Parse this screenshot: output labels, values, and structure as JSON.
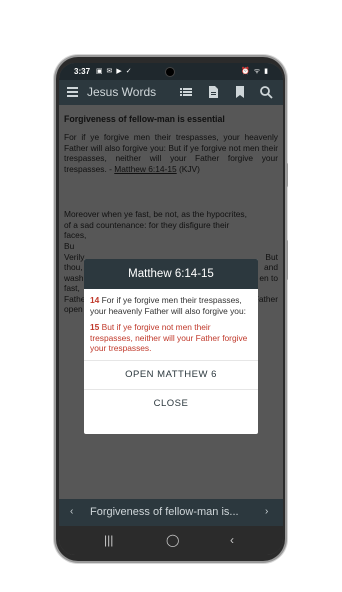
{
  "status_bar": {
    "time": "3:37",
    "left_icons": "▣ ✉ ▶ ✓",
    "right_icons": "⏰ ᯤ ▮"
  },
  "app_bar": {
    "title": "Jesus Words",
    "icons": [
      "menu-icon",
      "list-icon",
      "document-icon",
      "bookmark-icon",
      "search-icon"
    ]
  },
  "content": {
    "heading": "Forgiveness of fellow-man is essential",
    "paragraph1_pre": "For if ye forgive men their trespasses, your heavenly Father will also forgive you: But if ye forgive not men their trespasses, neither will your Father forgive your trespasses. - ",
    "paragraph1_link": "Matthew 6:14-15",
    "paragraph1_post": " (KJV)",
    "paragraph2_lines": [
      "Moreover when ye fast, be not, as the hypocrites,",
      "of a sad countenance: for they disfigure their",
      "faces,",
      "Bu",
      "Verily",
      "But",
      "thou,",
      "and",
      "wash",
      "en to",
      "fast,",
      "Father",
      "Father",
      "open"
    ]
  },
  "dialog": {
    "title": "Matthew 6:14-15",
    "verses": [
      {
        "num": "14",
        "text": "For if ye forgive men their trespasses, your heavenly Father will also forgive you:",
        "highlight": false
      },
      {
        "num": "15",
        "text": "But if ye forgive not men their trespasses, neither will your Father forgive your trespasses.",
        "highlight": true
      }
    ],
    "open_button": "OPEN MATTHEW 6",
    "close_button": "CLOSE"
  },
  "bottom_bar": {
    "label": "Forgiveness of fellow-man is...",
    "prev_icon": "‹",
    "next_icon": "›"
  },
  "nav_bar": {
    "recent": "|||",
    "home": "◯",
    "back": "‹"
  },
  "colors": {
    "primary": "#2c383e",
    "accent_red": "#c0392b",
    "scrim": "#575757"
  }
}
